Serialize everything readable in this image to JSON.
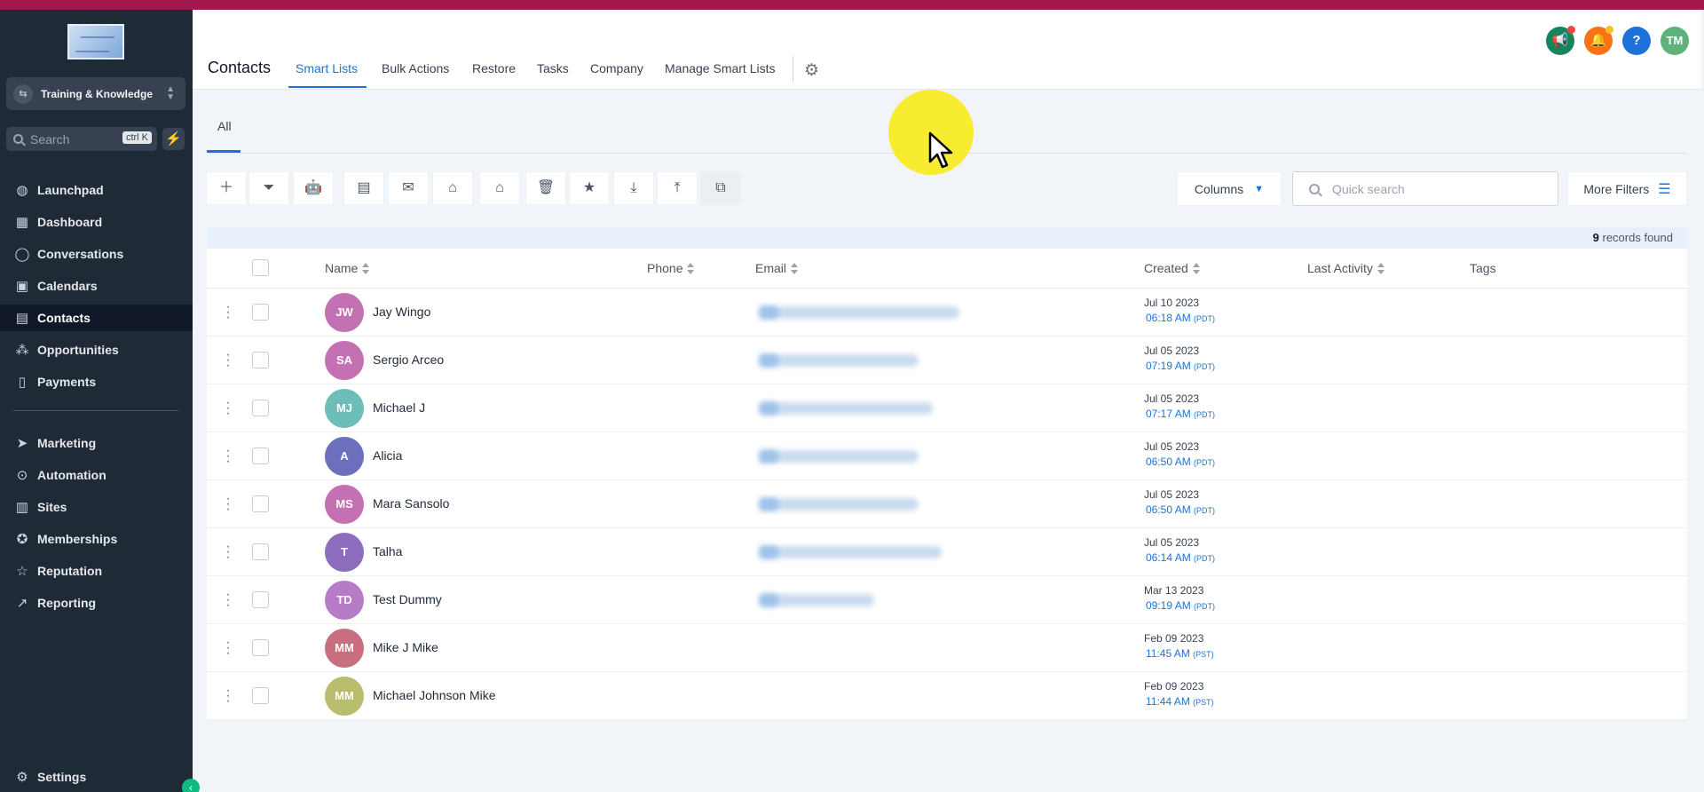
{
  "sidebar": {
    "account_name": "Training & Knowledge",
    "search_placeholder": "Search",
    "search_shortcut": "ctrl K",
    "items": [
      {
        "label": "Launchpad",
        "icon": "rocket-icon"
      },
      {
        "label": "Dashboard",
        "icon": "grid-icon"
      },
      {
        "label": "Conversations",
        "icon": "chat-icon"
      },
      {
        "label": "Calendars",
        "icon": "calendar-icon"
      },
      {
        "label": "Contacts",
        "icon": "contacts-icon",
        "active": true
      },
      {
        "label": "Opportunities",
        "icon": "opportunities-icon"
      },
      {
        "label": "Payments",
        "icon": "receipt-icon"
      },
      {
        "label": "Marketing",
        "icon": "send-icon"
      },
      {
        "label": "Automation",
        "icon": "automation-icon"
      },
      {
        "label": "Sites",
        "icon": "sites-icon"
      },
      {
        "label": "Memberships",
        "icon": "badge-icon"
      },
      {
        "label": "Reputation",
        "icon": "star-icon"
      },
      {
        "label": "Reporting",
        "icon": "trend-icon"
      }
    ],
    "settings_label": "Settings"
  },
  "header": {
    "title": "Contacts",
    "tabs": [
      "Smart Lists",
      "Bulk Actions",
      "Restore",
      "Tasks",
      "Company",
      "Manage Smart Lists"
    ],
    "active_tab": "Smart Lists",
    "user_initials": "TM",
    "help_label": "?"
  },
  "subtabs": [
    "All"
  ],
  "toolbar": {
    "icons": [
      "add-icon",
      "filter-icon",
      "robot-icon",
      "message-icon",
      "email-icon",
      "add-tag-icon",
      "remove-tag-icon",
      "delete-icon",
      "star-icon",
      "import-icon",
      "export-icon",
      "merge-icon"
    ],
    "columns_label": "Columns",
    "quick_search_placeholder": "Quick search",
    "more_filters_label": "More Filters"
  },
  "records": {
    "count": "9",
    "suffix": "records found"
  },
  "table": {
    "columns": [
      "Name",
      "Phone",
      "Email",
      "Created",
      "Last Activity",
      "Tags"
    ],
    "rows": [
      {
        "initials": "JW",
        "name": "Jay Wingo",
        "color": "#c471b3",
        "date": "Jul 10 2023",
        "time": "06:18 AM",
        "tz": "(PDT)",
        "email_blur": true
      },
      {
        "initials": "SA",
        "name": "Sergio Arceo",
        "color": "#c471b3",
        "date": "Jul 05 2023",
        "time": "07:19 AM",
        "tz": "(PDT)",
        "email_blur": true
      },
      {
        "initials": "MJ",
        "name": "Michael J",
        "color": "#6dbdb8",
        "date": "Jul 05 2023",
        "time": "07:17 AM",
        "tz": "(PDT)",
        "email_blur": true
      },
      {
        "initials": "A",
        "name": "Alicia",
        "color": "#6c6fbd",
        "date": "Jul 05 2023",
        "time": "06:50 AM",
        "tz": "(PDT)",
        "email_blur": true
      },
      {
        "initials": "MS",
        "name": "Mara Sansolo",
        "color": "#c471b3",
        "date": "Jul 05 2023",
        "time": "06:50 AM",
        "tz": "(PDT)",
        "email_blur": true
      },
      {
        "initials": "T",
        "name": "Talha",
        "color": "#8e6cbd",
        "date": "Jul 05 2023",
        "time": "06:14 AM",
        "tz": "(PDT)",
        "email_blur": true
      },
      {
        "initials": "TD",
        "name": "Test Dummy",
        "color": "#b77bc7",
        "date": "Mar 13 2023",
        "time": "09:19 AM",
        "tz": "(PDT)",
        "email_blur": true
      },
      {
        "initials": "MM",
        "name": "Mike J Mike",
        "color": "#c86f7f",
        "date": "Feb 09 2023",
        "time": "11:45 AM",
        "tz": "(PST)",
        "email_blur": false
      },
      {
        "initials": "MM",
        "name": "Michael Johnson Mike",
        "color": "#b7bd6c",
        "date": "Feb 09 2023",
        "time": "11:44 AM",
        "tz": "(PST)",
        "email_blur": false
      }
    ]
  },
  "colors": {
    "accent": "#1d72d9",
    "topbar": "#a3174f",
    "sidebar": "#1f2a37"
  }
}
